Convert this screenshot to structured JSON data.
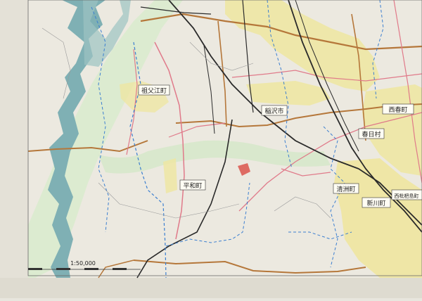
{
  "map": {
    "scale_label": "1:50,000",
    "place_labels": {
      "sofue": "祖父江町",
      "inazawa": "稲沢市",
      "heiwa": "平和町",
      "nishiharu": "西春町",
      "haruhi": "春日村",
      "kiyosu": "清洲町",
      "shinkawa": "新川町",
      "nishibiwajima": "西枇杷島町"
    },
    "colors": {
      "paper": "#ece9e0",
      "river_blue": "#7fb0b4",
      "urban_yellow": "#efe6a0",
      "green_belt": "#cfe3c4",
      "rail_black": "#2a2a2a",
      "road_pink": "#e07a8a",
      "road_brown": "#b5773a",
      "boundary_blue": "#3c7fd0",
      "highlight_red": "#d9403a"
    }
  }
}
